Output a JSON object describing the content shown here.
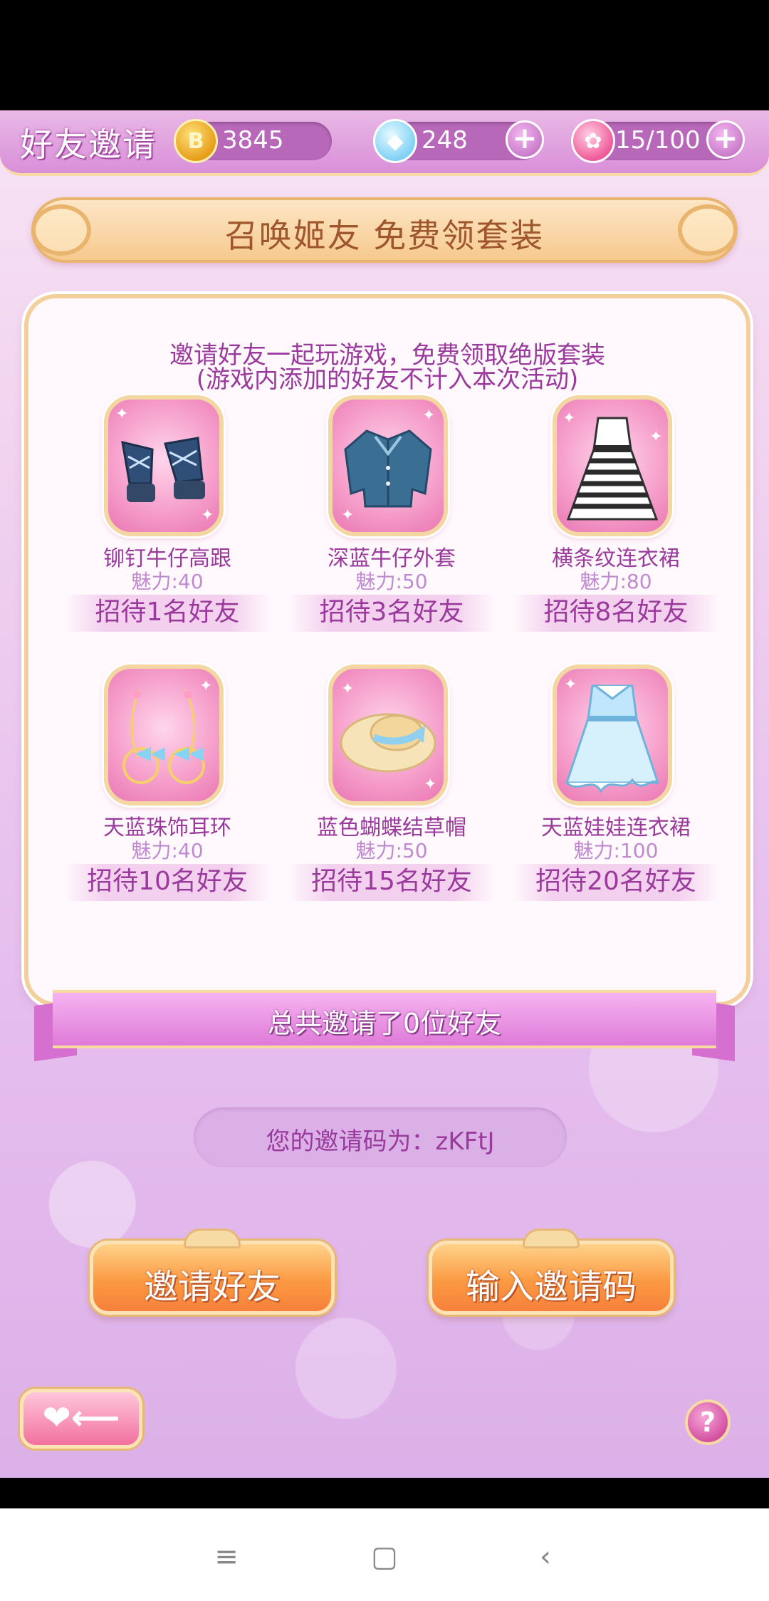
{
  "header": {
    "title": "好友邀请",
    "coins": "3845",
    "gems": "248",
    "roses": "15/100",
    "coin_icon": "coin-icon",
    "gem_icon": "diamond-icon",
    "rose_icon": "rose-icon"
  },
  "banner": {
    "text": "召唤姬友 免费领套装"
  },
  "intro": {
    "line1": "邀请好友一起玩游戏，免费领取绝版套装",
    "line2": "(游戏内添加的好友不计入本次活动)"
  },
  "rewards": [
    {
      "name": "铆钉牛仔高跟",
      "charm": "魅力:40",
      "requirement": "招待1名好友",
      "icon": "sandals-icon"
    },
    {
      "name": "深蓝牛仔外套",
      "charm": "魅力:50",
      "requirement": "招待3名好友",
      "icon": "denim-jacket-icon"
    },
    {
      "name": "横条纹连衣裙",
      "charm": "魅力:80",
      "requirement": "招待8名好友",
      "icon": "striped-dress-icon"
    },
    {
      "name": "天蓝珠饰耳环",
      "charm": "魅力:40",
      "requirement": "招待10名好友",
      "icon": "earrings-icon"
    },
    {
      "name": "蓝色蝴蝶结草帽",
      "charm": "魅力:50",
      "requirement": "招待15名好友",
      "icon": "straw-hat-icon"
    },
    {
      "name": "天蓝娃娃连衣裙",
      "charm": "魅力:100",
      "requirement": "招待20名好友",
      "icon": "doll-dress-icon"
    }
  ],
  "total": {
    "text": "总共邀请了0位好友"
  },
  "invite_code": {
    "text": "您的邀请码为：zKFtJ"
  },
  "actions": {
    "invite": "邀请好友",
    "enter_code": "输入邀请码"
  },
  "help": {
    "label": "?"
  },
  "nav": {
    "menu": "≡",
    "home": "▢",
    "back": "‹"
  }
}
